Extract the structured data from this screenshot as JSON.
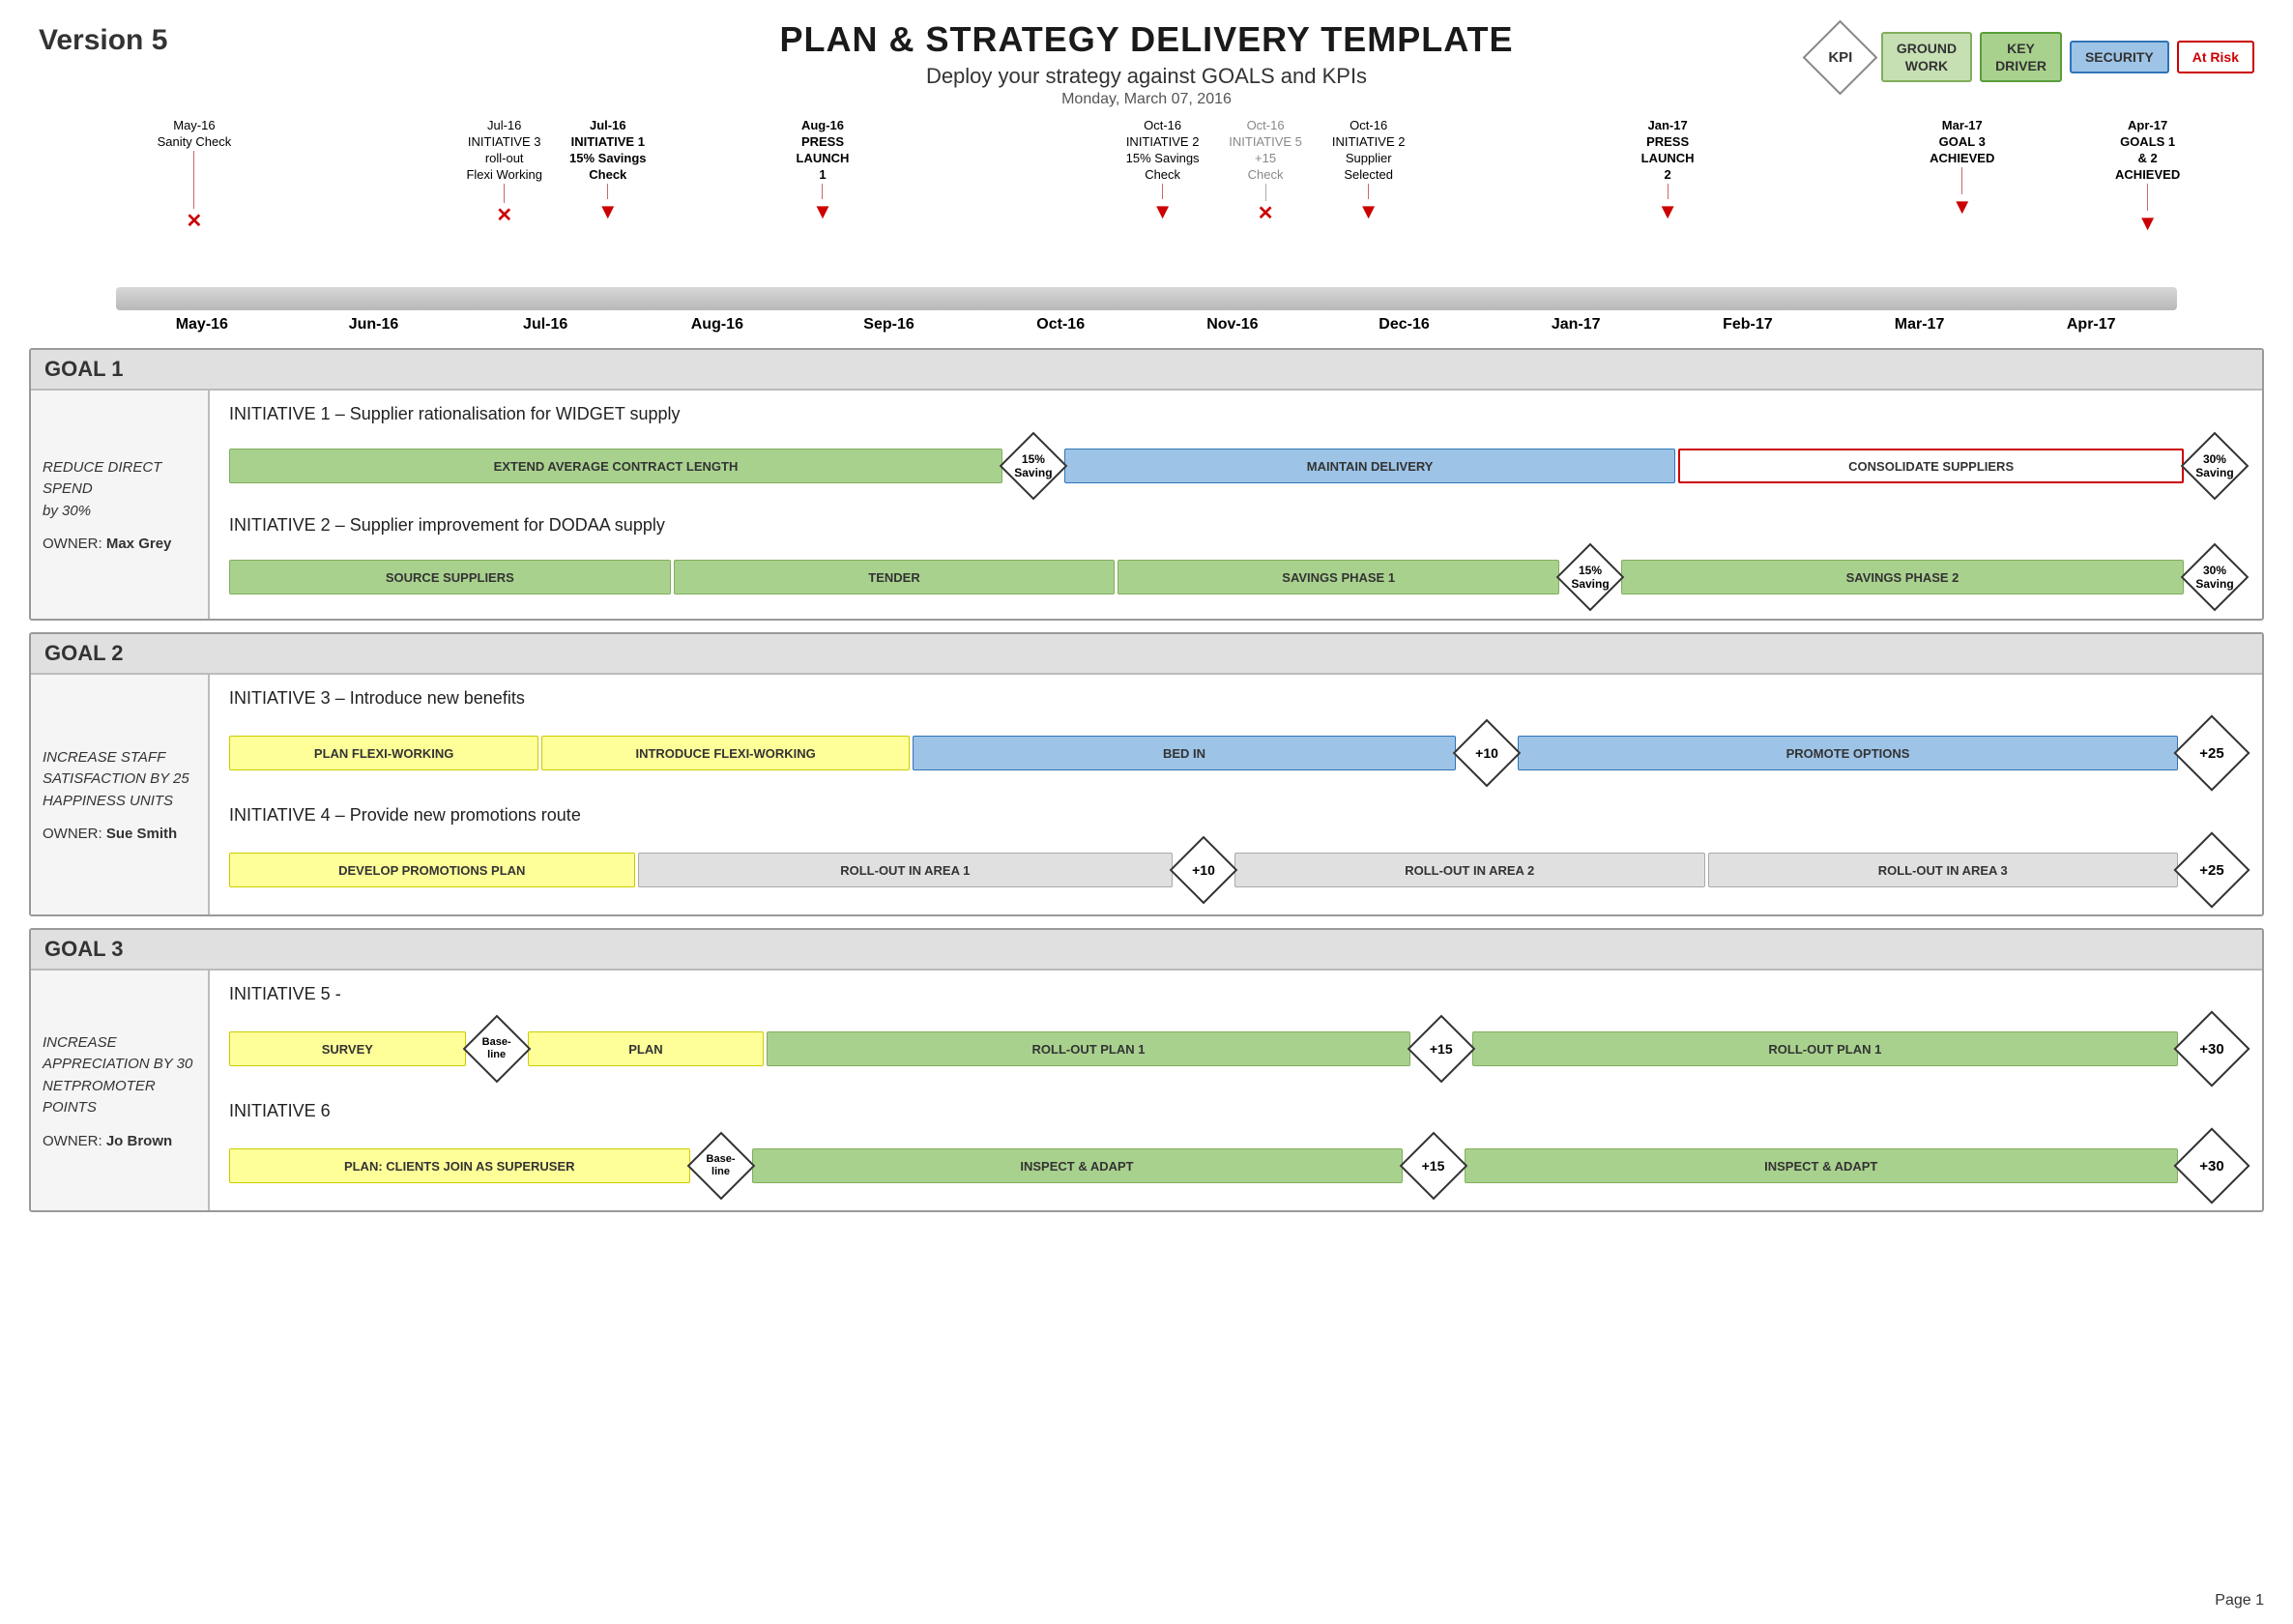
{
  "header": {
    "title": "PLAN & STRATEGY DELIVERY TEMPLATE",
    "subtitle": "Deploy your strategy against GOALS and KPIs",
    "date": "Monday, March 07, 2016",
    "version": "Version 5"
  },
  "legend": {
    "kpi_label": "KPI",
    "groundwork_label": "GROUND\nWORK",
    "keydriver_label": "KEY\nDRIVER",
    "security_label": "SECURITY",
    "atrisk_label": "At Risk"
  },
  "timeline": {
    "months": [
      "May-16",
      "Jun-16",
      "Jul-16",
      "Aug-16",
      "Sep-16",
      "Oct-16",
      "Nov-16",
      "Dec-16",
      "Jan-17",
      "Feb-17",
      "Mar-17",
      "Apr-17"
    ],
    "milestones": [
      {
        "date": "May-16",
        "label": "Sanity Check",
        "bold": false,
        "gray": false,
        "marker": "x",
        "pct": 4
      },
      {
        "date": "Jul-16",
        "label": "INITIATIVE 3\nroll-out\nFlexi Working",
        "bold": false,
        "gray": false,
        "marker": "x",
        "pct": 20
      },
      {
        "date": "Jul-16",
        "label": "INITIATIVE 1\n15% Savings\nCheck",
        "bold": true,
        "gray": false,
        "marker": "arrow",
        "pct": 24
      },
      {
        "date": "Aug-16",
        "label": "PRESS\nLAUNCH\n1",
        "bold": true,
        "gray": false,
        "marker": "arrow",
        "pct": 36
      },
      {
        "date": "Oct-16",
        "label": "INITIATIVE 2\n15% Savings\nCheck",
        "bold": false,
        "gray": false,
        "marker": "arrow",
        "pct": 52
      },
      {
        "date": "Oct-16",
        "label": "INITIATIVE 5\n+15\nCheck",
        "bold": false,
        "gray": true,
        "marker": "x",
        "pct": 58
      },
      {
        "date": "Oct-16",
        "label": "INITIATIVE 2\nSupplier\nSelected",
        "bold": false,
        "gray": false,
        "marker": "arrow",
        "pct": 63
      },
      {
        "date": "Jan-17",
        "label": "PRESS\nLAUNCH\n2",
        "bold": true,
        "gray": false,
        "marker": "arrow",
        "pct": 76
      },
      {
        "date": "Mar-17",
        "label": "GOAL 3\nACHIEVED",
        "bold": true,
        "gray": false,
        "marker": "arrow",
        "pct": 90
      },
      {
        "date": "Apr-17",
        "label": "GOALS 1 & 2\nACHIEVED",
        "bold": true,
        "gray": false,
        "marker": "arrow",
        "pct": 98
      }
    ]
  },
  "goals": [
    {
      "id": "goal1",
      "title": "GOAL 1",
      "sidebar_text": "REDUCE DIRECT SPEND\nby 30%",
      "owner_label": "OWNER:",
      "owner_name": "Max Grey",
      "initiatives": [
        {
          "id": "init1",
          "title": "INITIATIVE 1 – Supplier rationalisation for WIDGET supply",
          "bars": [
            {
              "label": "EXTEND AVERAGE CONTRACT LENGTH",
              "type": "green",
              "flex": 28
            },
            {
              "label": "15%\nSaving",
              "type": "diamond",
              "size": "small"
            },
            {
              "label": "MAINTAIN DELIVERY",
              "type": "blue",
              "flex": 22
            },
            {
              "label": "CONSOLIDATE SUPPLIERS",
              "type": "red-outline",
              "flex": 18
            },
            {
              "label": "30%\nSaving",
              "type": "diamond",
              "size": "small"
            }
          ]
        },
        {
          "id": "init2",
          "title": "INITIATIVE 2 – Supplier improvement for DODAA supply",
          "bars": [
            {
              "label": "SOURCE SUPPLIERS",
              "type": "green",
              "flex": 14
            },
            {
              "label": "TENDER",
              "type": "green",
              "flex": 14
            },
            {
              "label": "SAVINGS PHASE 1",
              "type": "green",
              "flex": 14
            },
            {
              "label": "15%\nSaving",
              "type": "diamond",
              "size": "small"
            },
            {
              "label": "SAVINGS PHASE 2",
              "type": "green",
              "flex": 18
            },
            {
              "label": "30%\nSaving",
              "type": "diamond",
              "size": "small"
            }
          ]
        }
      ]
    },
    {
      "id": "goal2",
      "title": "GOAL 2",
      "sidebar_text": "INCREASE STAFF SATISFACTION BY 25 HAPPINESS UNITS",
      "owner_label": "OWNER:",
      "owner_name": "Sue Smith",
      "initiatives": [
        {
          "id": "init3",
          "title": "INITIATIVE 3 – Introduce new benefits",
          "bars": [
            {
              "label": "PLAN FLEXI-WORKING",
              "type": "yellow",
              "flex": 10
            },
            {
              "label": "INTRODUCE FLEXI-WORKING",
              "type": "yellow",
              "flex": 12
            },
            {
              "label": "BED IN",
              "type": "blue",
              "flex": 18
            },
            {
              "label": "+10",
              "type": "diamond",
              "size": "small"
            },
            {
              "label": "PROMOTE OPTIONS",
              "type": "blue",
              "flex": 22
            },
            {
              "label": "+25",
              "type": "diamond",
              "size": "large"
            }
          ]
        },
        {
          "id": "init4",
          "title": "INITIATIVE 4 – Provide new promotions route",
          "bars": [
            {
              "label": "DEVELOP PROMOTIONS PLAN",
              "type": "yellow",
              "flex": 12
            },
            {
              "label": "ROLL-OUT IN AREA 1",
              "type": "gray",
              "flex": 16
            },
            {
              "label": "+10",
              "type": "diamond",
              "size": "small"
            },
            {
              "label": "ROLL-OUT IN AREA 2",
              "type": "gray",
              "flex": 14
            },
            {
              "label": "ROLL-OUT IN AREA 3",
              "type": "gray",
              "flex": 14
            },
            {
              "label": "+25",
              "type": "diamond",
              "size": "large"
            }
          ]
        }
      ]
    },
    {
      "id": "goal3",
      "title": "GOAL 3",
      "sidebar_text": "INCREASE APPRECIATION BY 30 NETPROMOTER POINTS",
      "owner_label": "OWNER:",
      "owner_name": "Jo Brown",
      "initiatives": [
        {
          "id": "init5",
          "title": "INITIATIVE 5 -",
          "bars": [
            {
              "label": "SURVEY",
              "type": "yellow",
              "flex": 7
            },
            {
              "label": "Base-\nline",
              "type": "diamond",
              "size": "small"
            },
            {
              "label": "PLAN",
              "type": "yellow",
              "flex": 7
            },
            {
              "label": "ROLL-OUT PLAN 1",
              "type": "green",
              "flex": 20
            },
            {
              "label": "+15",
              "type": "diamond",
              "size": "small"
            },
            {
              "label": "ROLL-OUT PLAN 1",
              "type": "green",
              "flex": 22
            },
            {
              "label": "+30",
              "type": "diamond",
              "size": "large"
            }
          ]
        },
        {
          "id": "init6",
          "title": "INITIATIVE 6",
          "bars": [
            {
              "label": "PLAN: CLIENTS JOIN AS SUPERUSER",
              "type": "yellow",
              "flex": 14
            },
            {
              "label": "Base-\nline",
              "type": "diamond",
              "size": "small"
            },
            {
              "label": "INSPECT & ADAPT",
              "type": "green",
              "flex": 20
            },
            {
              "label": "+15",
              "type": "diamond",
              "size": "small"
            },
            {
              "label": "INSPECT & ADAPT",
              "type": "green",
              "flex": 22
            },
            {
              "label": "+30",
              "type": "diamond",
              "size": "large"
            }
          ]
        }
      ]
    }
  ],
  "page_number": "Page 1"
}
